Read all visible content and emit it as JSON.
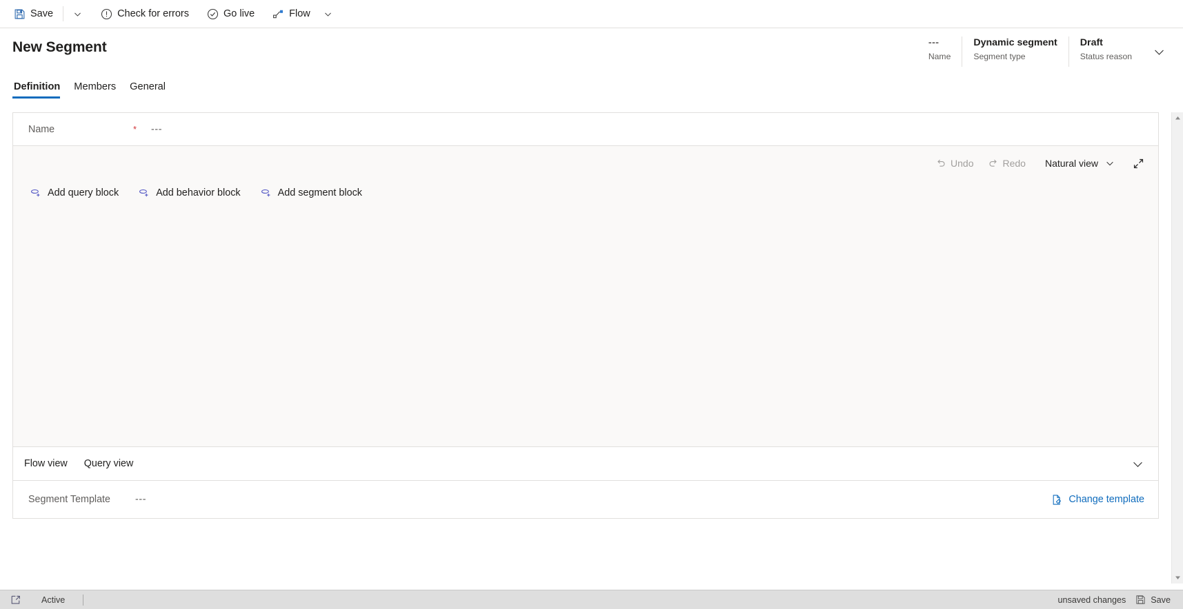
{
  "commandbar": {
    "save_label": "Save",
    "save_icon": "save-floppy-icon",
    "save_caret_icon": "chevron-down-icon",
    "check_errors_label": "Check for errors",
    "check_errors_icon": "exclamation-circle-icon",
    "go_live_label": "Go live",
    "go_live_icon": "check-circle-icon",
    "flow_label": "Flow",
    "flow_icon": "flow-node-icon",
    "flow_caret_icon": "chevron-down-icon"
  },
  "header": {
    "title": "New Segment",
    "fields": [
      {
        "value": "---",
        "label": "Name",
        "muted": true
      },
      {
        "value": "Dynamic segment",
        "label": "Segment type",
        "muted": false
      },
      {
        "value": "Draft",
        "label": "Status reason",
        "muted": false
      }
    ],
    "expand_icon": "chevron-down-icon"
  },
  "tabs": [
    {
      "label": "Definition",
      "active": true
    },
    {
      "label": "Members",
      "active": false
    },
    {
      "label": "General",
      "active": false
    }
  ],
  "form": {
    "name_label": "Name",
    "name_required_marker": "*",
    "name_value": "---"
  },
  "builder": {
    "toolbar": {
      "undo_label": "Undo",
      "undo_icon": "undo-arrow-icon",
      "undo_disabled": true,
      "redo_label": "Redo",
      "redo_icon": "redo-arrow-icon",
      "redo_disabled": true,
      "view_mode_label": "Natural view",
      "view_mode_caret_icon": "chevron-down-icon",
      "expand_icon": "expand-diagonal-icon"
    },
    "actions": [
      {
        "label": "Add query block",
        "icon": "add-query-block-icon"
      },
      {
        "label": "Add behavior block",
        "icon": "add-behavior-block-icon"
      },
      {
        "label": "Add segment block",
        "icon": "add-segment-block-icon"
      }
    ]
  },
  "views": {
    "tabs": [
      {
        "label": "Flow view"
      },
      {
        "label": "Query view"
      }
    ],
    "collapse_icon": "chevron-down-icon"
  },
  "template": {
    "label": "Segment Template",
    "value": "---",
    "change_label": "Change template",
    "change_icon": "edit-document-icon"
  },
  "scrollbar": {
    "up_icon": "caret-up-icon",
    "down_icon": "caret-down-icon"
  },
  "statusbar": {
    "popout_icon": "popout-window-icon",
    "state_label": "Active",
    "unsaved_label": "unsaved changes",
    "save_label": "Save",
    "save_icon": "save-floppy-icon"
  },
  "colors": {
    "accent": "#0f6cbd",
    "required": "#d13438",
    "muted_text": "#605e5c",
    "disabled_text": "#a19f9d",
    "canvas_bg": "#faf9f8",
    "border": "#e1dfdd",
    "statusbar_bg": "#dedede"
  }
}
